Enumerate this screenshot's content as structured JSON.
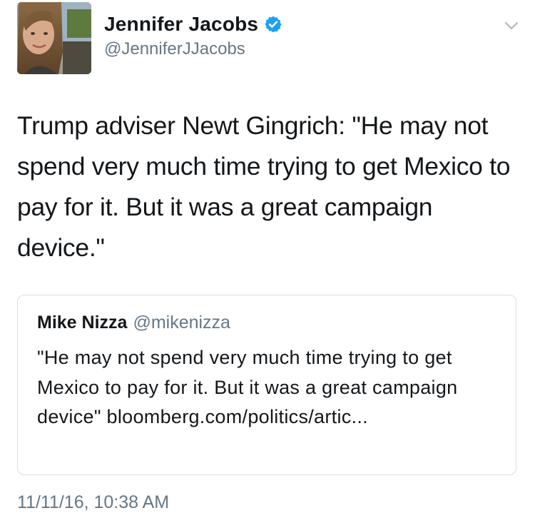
{
  "author": {
    "display_name": "Jennifer Jacobs",
    "handle": "@JenniferJJacobs",
    "verified": true
  },
  "tweet": {
    "text": "Trump adviser Newt Gingrich: \"He may not spend very much time trying to get Mexico to pay for it. But it was a great campaign device.\"",
    "timestamp": "11/11/16, 10:38 AM"
  },
  "quoted_tweet": {
    "display_name": "Mike Nizza",
    "handle": "@mikenizza",
    "text": "\"He may not spend very much time trying to get Mexico to pay for it. But it was a great campaign device\" bloomberg.com/politics/artic..."
  },
  "icons": {
    "verified": "verified-badge-icon",
    "more": "chevron-down-icon"
  },
  "colors": {
    "verified_blue": "#1da1f2",
    "secondary_text": "#657786",
    "primary_text": "#14171a",
    "card_border": "#d8dee3"
  }
}
